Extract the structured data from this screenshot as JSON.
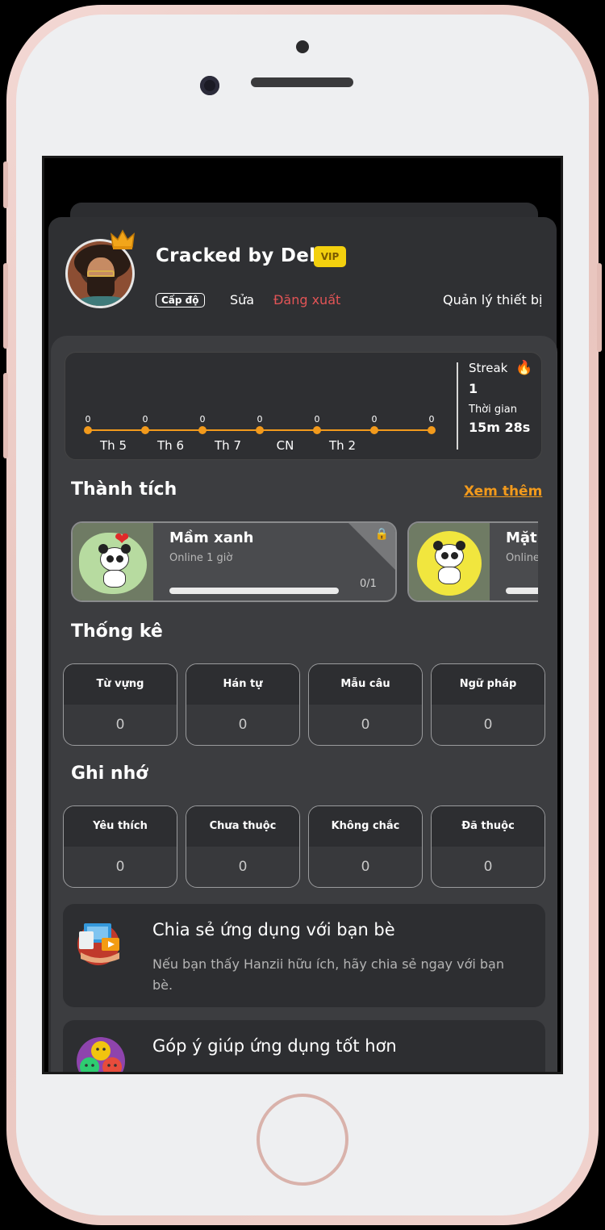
{
  "profile": {
    "name": "Cracked by Dell",
    "badge": "VIP",
    "level_label": "Cấp độ",
    "edit_label": "Sửa",
    "logout_label": "Đăng xuất",
    "devices_label": "Quản lý thiết bị"
  },
  "streak": {
    "streak_label": "Streak",
    "streak_value": "1",
    "time_label": "Thời gian",
    "time_value": "15m 28s",
    "fire_icon": "🔥"
  },
  "chart_data": {
    "type": "line",
    "categories": [
      "Th 5",
      "Th 6",
      "Th 7",
      "CN",
      "Th 2"
    ],
    "values": [
      0,
      0,
      0,
      0,
      0,
      0,
      0
    ],
    "point_labels": [
      "0",
      "0",
      "0",
      "0",
      "0",
      "0",
      "0"
    ],
    "color": "#f29a1c"
  },
  "achievements": {
    "title": "Thành tích",
    "see_more": "Xem thêm",
    "items": [
      {
        "title": "Mầm xanh",
        "subtitle": "Online 1 giờ",
        "progress_text": "0/1",
        "progress": 0,
        "locked": true
      },
      {
        "title": "Mặt",
        "subtitle": "Online",
        "progress": 0
      }
    ]
  },
  "stats": {
    "title": "Thống kê",
    "items": [
      {
        "label": "Từ vựng",
        "value": "0"
      },
      {
        "label": "Hán tự",
        "value": "0"
      },
      {
        "label": "Mẫu câu",
        "value": "0"
      },
      {
        "label": "Ngữ pháp",
        "value": "0"
      }
    ]
  },
  "memory": {
    "title": "Ghi nhớ",
    "items": [
      {
        "label": "Yêu thích",
        "value": "0"
      },
      {
        "label": "Chưa thuộc",
        "value": "0"
      },
      {
        "label": "Không chắc",
        "value": "0"
      },
      {
        "label": "Đã thuộc",
        "value": "0"
      }
    ]
  },
  "promo": {
    "share_title": "Chia sẻ ứng dụng với bạn bè",
    "share_desc": "Nếu bạn thấy Hanzii hữu ích, hãy chia sẻ ngay với bạn bè.",
    "feedback_title": "Góp ý giúp ứng dụng tốt hơn"
  },
  "colors": {
    "accent": "#f29a1c",
    "vip": "#f3d00e",
    "logout": "#e25456"
  }
}
